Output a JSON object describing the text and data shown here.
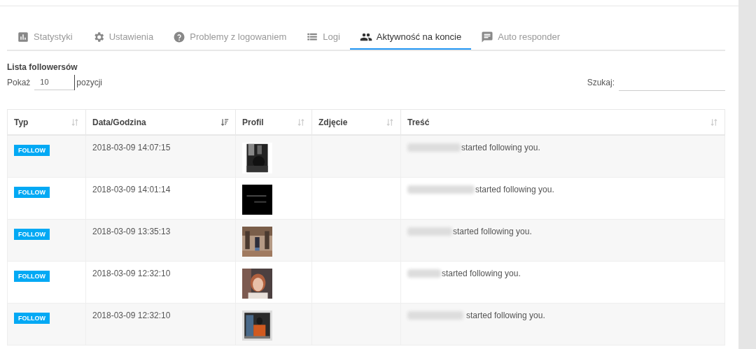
{
  "tabs": [
    {
      "label": "Statystyki",
      "selected": false
    },
    {
      "label": "Ustawienia",
      "selected": false
    },
    {
      "label": "Problemy z logowaniem",
      "selected": false
    },
    {
      "label": "Logi",
      "selected": false
    },
    {
      "label": "Aktywność na koncie",
      "selected": true
    },
    {
      "label": "Auto responder",
      "selected": false
    }
  ],
  "section_title": "Lista followersów",
  "length_control": {
    "before": "Pokaż",
    "value": "10",
    "after": "pozycji"
  },
  "search": {
    "label": "Szukaj:"
  },
  "table": {
    "columns": [
      {
        "label": "Typ",
        "sorted": false
      },
      {
        "label": "Data/Godzina",
        "sorted": true
      },
      {
        "label": "Profil",
        "sorted": false
      },
      {
        "label": "Zdjęcie",
        "sorted": false
      },
      {
        "label": "Treść",
        "sorted": false
      }
    ],
    "rows": [
      {
        "type": "FOLLOW",
        "datetime": "2018-03-09 14:07:15",
        "redacted": true,
        "text": "started following you."
      },
      {
        "type": "FOLLOW",
        "datetime": "2018-03-09 14:01:14",
        "redacted": true,
        "text": "started following you."
      },
      {
        "type": "FOLLOW",
        "datetime": "2018-03-09 13:35:13",
        "redacted": true,
        "text": "started following you."
      },
      {
        "type": "FOLLOW",
        "datetime": "2018-03-09 12:32:10",
        "redacted": true,
        "text": "started following you."
      },
      {
        "type": "FOLLOW",
        "datetime": "2018-03-09 12:32:10",
        "redacted": true,
        "text": "started following you."
      }
    ]
  }
}
